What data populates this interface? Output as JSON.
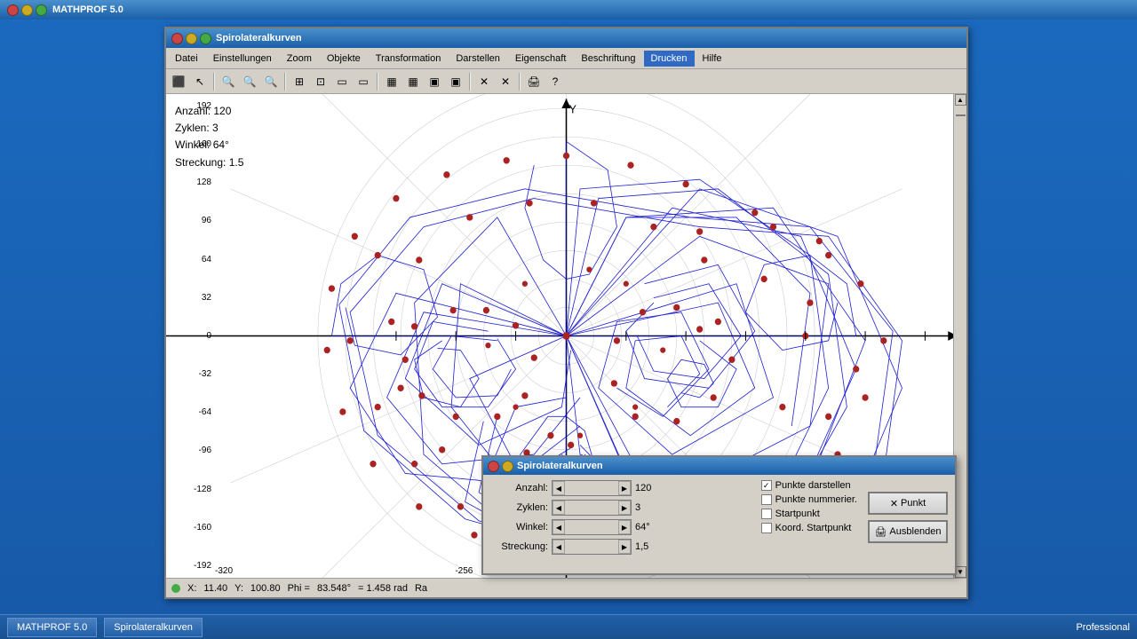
{
  "app": {
    "title": "MATHPROF 5.0",
    "edition": "Professional"
  },
  "main_window": {
    "title": "Spirolateralkurven"
  },
  "menubar": {
    "items": [
      {
        "label": "Datei"
      },
      {
        "label": "Einstellungen"
      },
      {
        "label": "Zoom"
      },
      {
        "label": "Objekte"
      },
      {
        "label": "Transformation"
      },
      {
        "label": "Darstellen"
      },
      {
        "label": "Eigenschaft"
      },
      {
        "label": "Beschriftung"
      },
      {
        "label": "Drucken"
      },
      {
        "label": "Hilfe"
      }
    ]
  },
  "graph": {
    "info": {
      "anzahl_label": "Anzahl:",
      "anzahl_value": "120",
      "zyklen_label": "Zyklen:",
      "zyklen_value": "3",
      "winkel_label": "Winkel:",
      "winkel_value": "64°",
      "streckung_label": "Streckung:",
      "streckung_value": "1.5"
    }
  },
  "statusbar": {
    "x_label": "X:",
    "x_value": "11.40",
    "y_label": "Y:",
    "y_value": "100.80",
    "phi_label": "Phi =",
    "phi_value": "83.548°",
    "rad_label": "= 1.458 rad",
    "ra_label": "Ra"
  },
  "params_dialog": {
    "title": "Spirolateralkurven",
    "params": [
      {
        "label": "Anzahl:",
        "value": "120"
      },
      {
        "label": "Zyklen:",
        "value": "3"
      },
      {
        "label": "Winkel:",
        "value": "64°"
      },
      {
        "label": "Streckung:",
        "value": "1,5"
      }
    ],
    "checkboxes": [
      {
        "label": "Punkte darstellen",
        "checked": true
      },
      {
        "label": "Punkte nummerier.",
        "checked": false
      },
      {
        "label": "Startpunkt",
        "checked": false
      },
      {
        "label": "Koord. Startpunkt",
        "checked": false
      }
    ],
    "buttons": [
      {
        "label": "Punkt",
        "icon": "×"
      },
      {
        "label": "Ausblenden",
        "icon": "🖨"
      }
    ]
  },
  "taskbar": {
    "items": [
      {
        "label": "MATHPROF 5.0"
      },
      {
        "label": "Spirolateralkurven"
      }
    ],
    "edition": "Professional"
  }
}
